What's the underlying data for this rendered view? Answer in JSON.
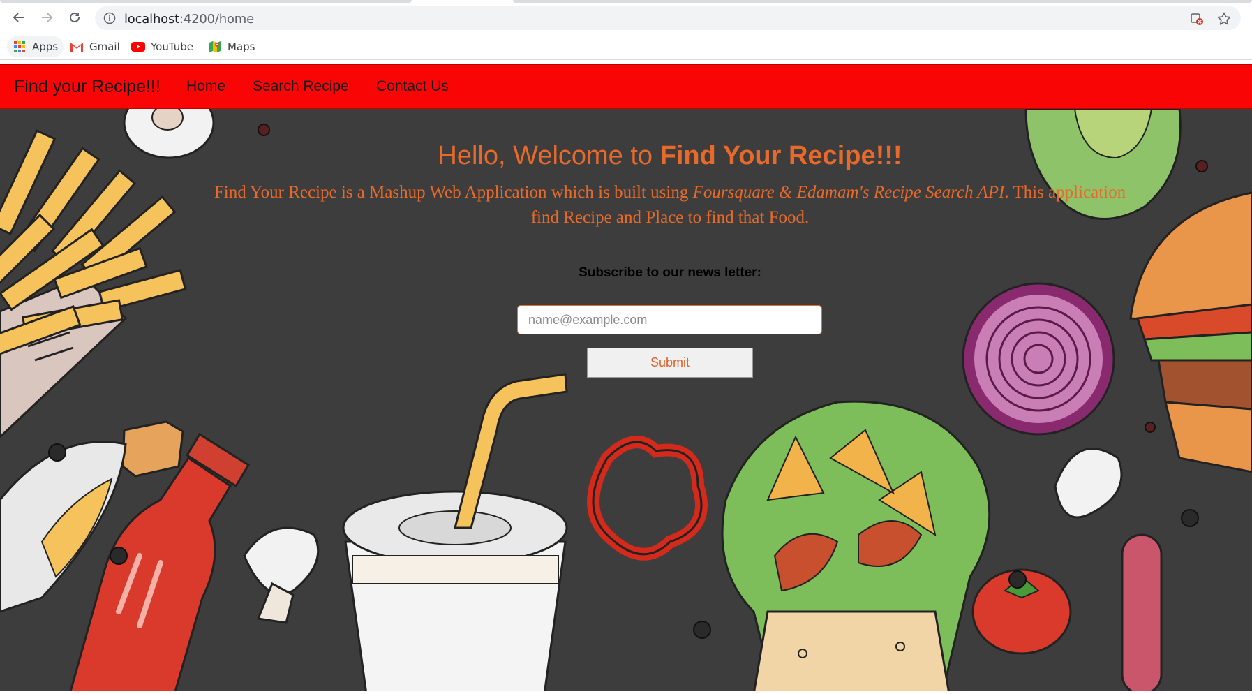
{
  "browser": {
    "url_host": "localhost",
    "url_path": ":4200/home",
    "bookmarks": [
      {
        "label": "Apps",
        "icon": "apps-grid-icon"
      },
      {
        "label": "Gmail",
        "icon": "gmail-icon"
      },
      {
        "label": "YouTube",
        "icon": "youtube-icon"
      },
      {
        "label": "Maps",
        "icon": "maps-icon"
      }
    ]
  },
  "navbar": {
    "brand": "Find your Recipe!!!",
    "links": [
      "Home",
      "Search Recipe",
      "Contact Us"
    ],
    "background": "#fa0505"
  },
  "hero": {
    "headline_prefix": "Hello, Welcome to ",
    "headline_bold": "Find Your Recipe!!!",
    "intro_part1": "Find Your Recipe is a Mashup Web Application which is built using ",
    "intro_italic": "Foursquare & Edamam's Recipe Search API",
    "intro_part2": ". This application find Recipe and Place to find that Food.",
    "subscribe_label": "Subscribe to our news letter:",
    "email_placeholder": "name@example.com",
    "submit_label": "Submit",
    "accent_color": "#e86a2b"
  }
}
